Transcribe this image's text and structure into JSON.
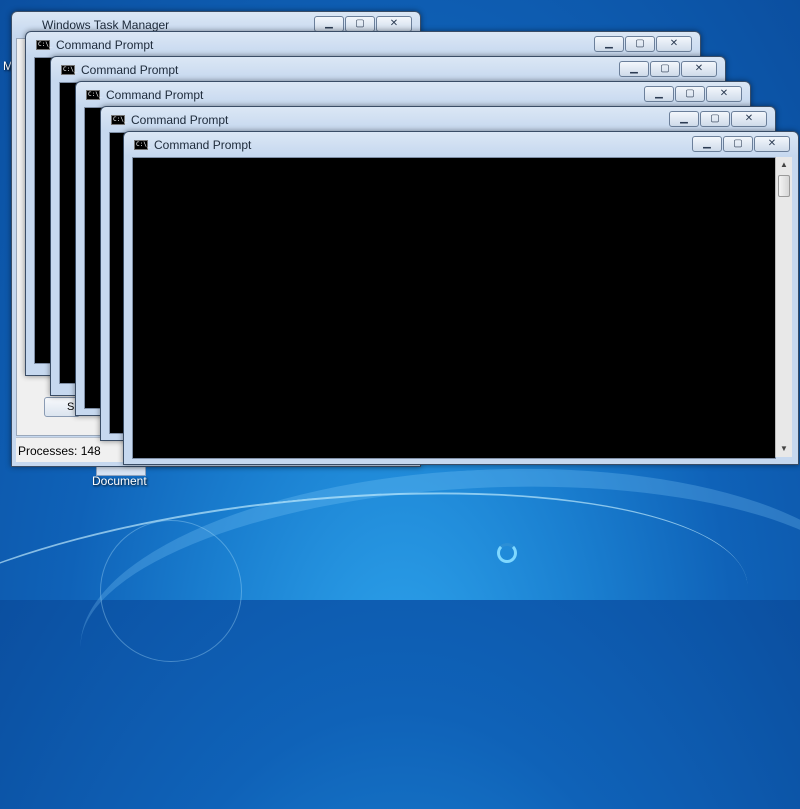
{
  "desktop": {
    "left_edge_letter": "M",
    "document_label": "Document"
  },
  "task_manager": {
    "title": "Windows Task Manager",
    "processes_status": "Processes: 148",
    "button_label": "Sh"
  },
  "console_windows": [
    {
      "title": "Command Prompt"
    },
    {
      "title": "Command Prompt"
    },
    {
      "title": "Command Prompt"
    },
    {
      "title": "Command Prompt"
    },
    {
      "title": "Command Prompt"
    }
  ],
  "caption_buttons": {
    "minimize": "▁",
    "maximize": "▢",
    "close": "✕"
  },
  "icons": {
    "console_icon_text": "C:\\_",
    "busy_cursor": "busy-spinner-icon"
  }
}
